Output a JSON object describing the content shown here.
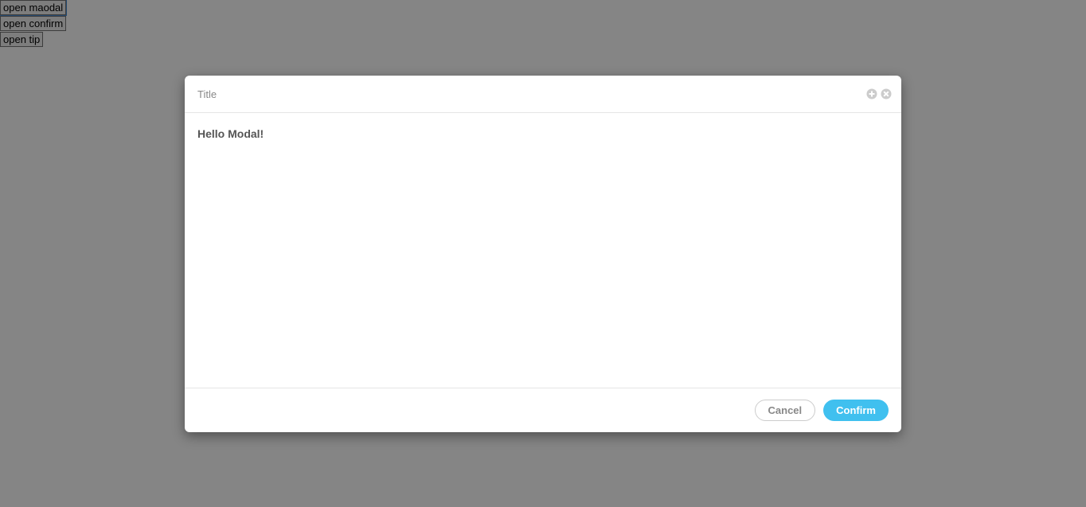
{
  "background": {
    "buttons": [
      {
        "label": "open maodal"
      },
      {
        "label": "open confirm"
      },
      {
        "label": "open tip"
      }
    ]
  },
  "modal": {
    "title": "Title",
    "body": "Hello Modal!",
    "footer": {
      "cancel": "Cancel",
      "confirm": "Confirm"
    }
  }
}
